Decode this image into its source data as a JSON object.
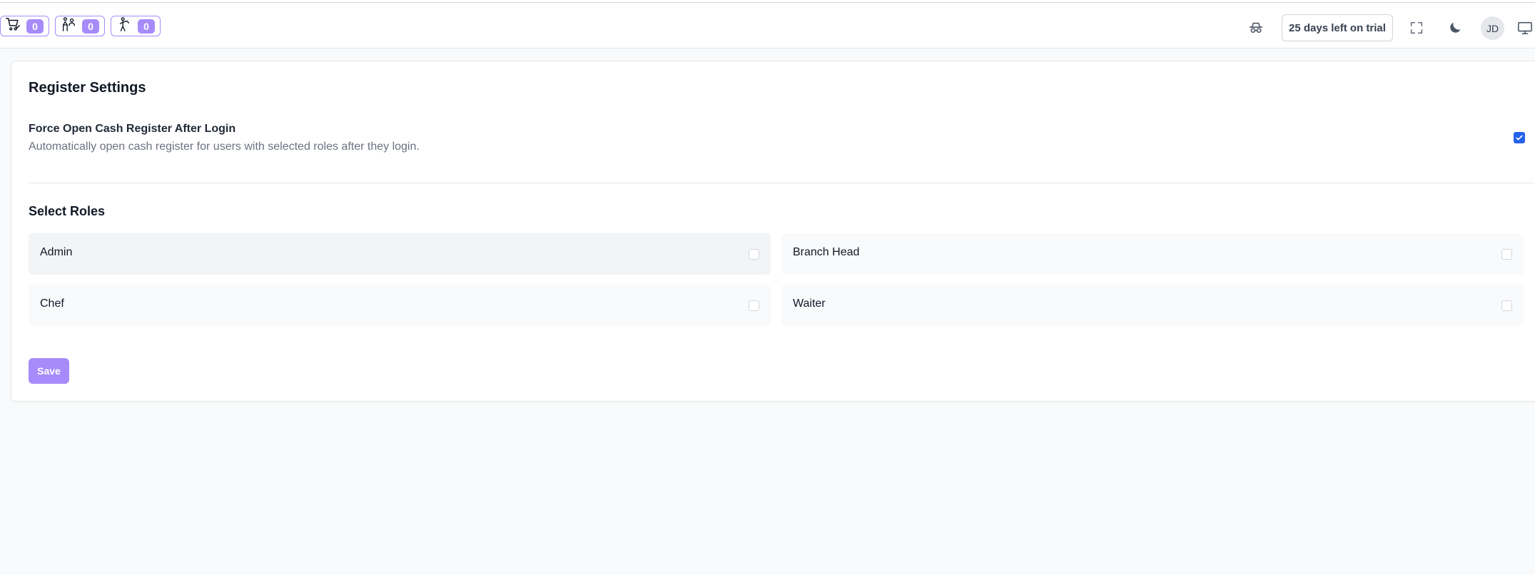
{
  "header": {
    "counters": [
      {
        "name": "cart-orders",
        "icon": "cart-check-icon",
        "count": "0"
      },
      {
        "name": "waiter-orders",
        "icon": "waiter-icon",
        "count": "0"
      },
      {
        "name": "chef-orders",
        "icon": "chef-icon",
        "count": "0"
      }
    ],
    "trial_label": "25 days left on trial",
    "avatar_initials": "JD",
    "icons": [
      "incognito-icon",
      "fullscreen-icon",
      "moon-icon",
      "monitor-icon"
    ]
  },
  "settings": {
    "title": "Register Settings",
    "force_open": {
      "title": "Force Open Cash Register After Login",
      "description": "Automatically open cash register for users with selected roles after they login.",
      "checked": true
    },
    "roles_title": "Select Roles",
    "roles": [
      {
        "label": "Admin",
        "checked": false
      },
      {
        "label": "Branch Head",
        "checked": false
      },
      {
        "label": "Chef",
        "checked": false
      },
      {
        "label": "Waiter",
        "checked": false
      }
    ],
    "save_label": "Save"
  },
  "colors": {
    "accent": "#a78bfa",
    "checkbox_checked": "#2563eb",
    "page_bg": "#f9fafb"
  }
}
